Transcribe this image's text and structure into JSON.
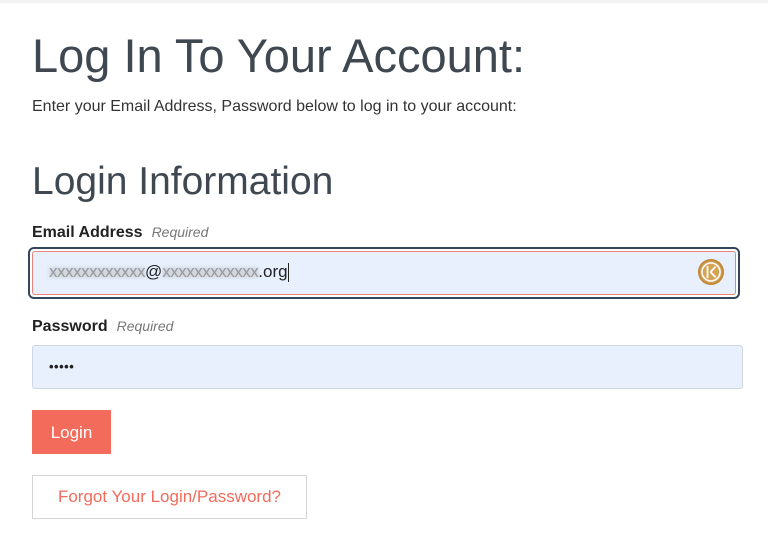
{
  "page": {
    "title": "Log In To Your Account:",
    "intro": "Enter your Email Address, Password below to log in to your account:",
    "section_title": "Login Information"
  },
  "email": {
    "label": "Email Address",
    "required": "Required",
    "value_masked_user": "xxxxxxxxxxxx",
    "value_at": "@",
    "value_masked_domain": "xxxxxxxxxxxx",
    "value_tld": ".org",
    "autofill_icon": "keeper-icon"
  },
  "password": {
    "label": "Password",
    "required": "Required",
    "value": "•••••"
  },
  "actions": {
    "login_label": "Login",
    "forgot_label": "Forgot Your Login/Password?"
  },
  "colors": {
    "accent": "#f26b5b",
    "heading": "#3f4750",
    "input_fill": "#e8f0fe",
    "focus_ring": "#35465c",
    "error_border": "#e9847a"
  }
}
